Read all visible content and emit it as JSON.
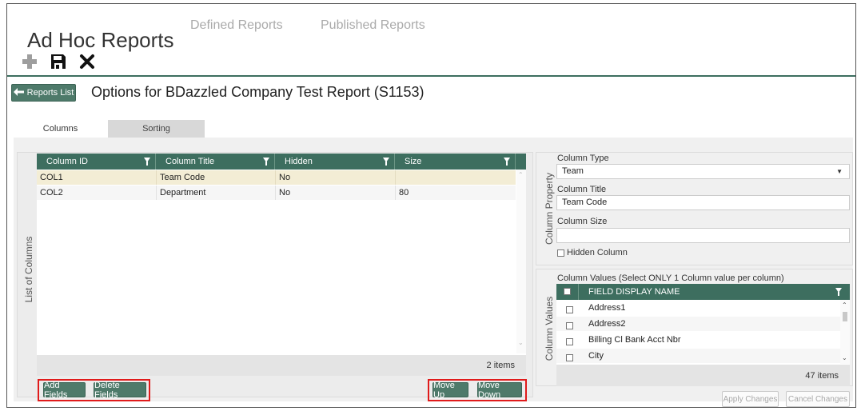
{
  "app": {
    "title": "Ad Hoc Reports",
    "nav": [
      "Defined Reports",
      "Published Reports"
    ]
  },
  "toolbar": {
    "icons": [
      "plus-icon",
      "save-icon",
      "close-icon"
    ]
  },
  "header": {
    "back_button": "Reports List",
    "title": "Options for BDazzled Company Test Report (S1153)"
  },
  "tabs": [
    "Columns",
    "Sorting"
  ],
  "list_of_columns": {
    "label": "List of Columns",
    "headers": [
      "Column ID",
      "Column Title",
      "Hidden",
      "Size"
    ],
    "rows": [
      [
        "COL1",
        "Team Code",
        "No",
        ""
      ],
      [
        "COL2",
        "Department",
        "No",
        "80"
      ]
    ],
    "item_count": "2 items",
    "buttons": {
      "add": "Add Fields",
      "delete": "Delete Fields",
      "move_up": "Move Up",
      "move_down": "Move Down"
    }
  },
  "column_property": {
    "label": "Column Property",
    "type_label": "Column Type",
    "type_value": "Team",
    "title_label": "Column Title",
    "title_value": "Team Code",
    "size_label": "Column Size",
    "size_value": "",
    "hidden_label": "Hidden Column"
  },
  "column_values": {
    "label": "Column Values",
    "note": "Column Values (Select ONLY 1 Column value per column)",
    "header": "FIELD DISPLAY NAME",
    "rows": [
      "Address1",
      "Address2",
      "Billing Cl Bank Acct Nbr",
      "City"
    ],
    "item_count": "47 items"
  },
  "actions": {
    "apply": "Apply Changes",
    "cancel": "Cancel Changes"
  },
  "colors": {
    "accent": "#3d6e5f",
    "selected_row": "#f3edd5",
    "highlight_box": "#e01b1b"
  }
}
